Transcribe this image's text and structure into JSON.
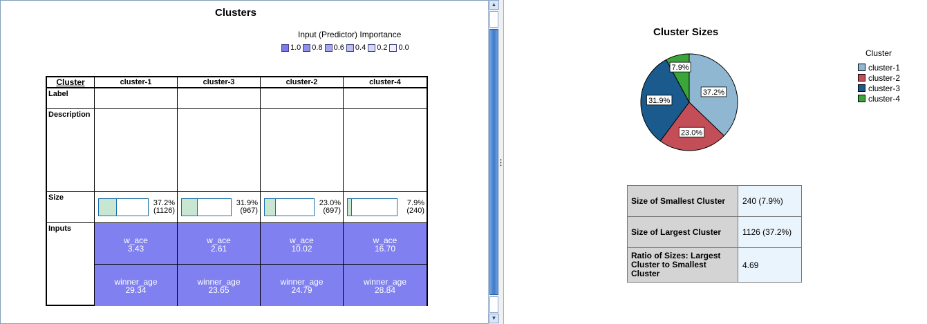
{
  "left": {
    "title": "Clusters",
    "importance": {
      "title": "Input (Predictor) Importance",
      "levels": [
        {
          "label": "1.0",
          "color": "#7b7bee"
        },
        {
          "label": "0.8",
          "color": "#8f8ff0"
        },
        {
          "label": "0.6",
          "color": "#a6a6f3"
        },
        {
          "label": "0.4",
          "color": "#bebef6"
        },
        {
          "label": "0.2",
          "color": "#d6d6f9"
        },
        {
          "label": "0.0",
          "color": "#efeffd"
        }
      ]
    },
    "grid": {
      "corner": "Cluster",
      "row_labels": {
        "label": "Label",
        "description": "Description",
        "size": "Size",
        "inputs": "Inputs"
      },
      "clusters": [
        {
          "name": "cluster-1",
          "size_pct": "37.2%",
          "size_n": "(1126)",
          "fill": 0.372,
          "inputs": [
            {
              "name": "w_ace",
              "value": "3.43"
            },
            {
              "name": "winner_age",
              "value": "29.34"
            }
          ]
        },
        {
          "name": "cluster-3",
          "size_pct": "31.9%",
          "size_n": "(967)",
          "fill": 0.319,
          "inputs": [
            {
              "name": "w_ace",
              "value": "2.61"
            },
            {
              "name": "winner_age",
              "value": "23.65"
            }
          ]
        },
        {
          "name": "cluster-2",
          "size_pct": "23.0%",
          "size_n": "(697)",
          "fill": 0.23,
          "inputs": [
            {
              "name": "w_ace",
              "value": "10.02"
            },
            {
              "name": "winner_age",
              "value": "24.79"
            }
          ]
        },
        {
          "name": "cluster-4",
          "size_pct": "7.9%",
          "size_n": "(240)",
          "fill": 0.079,
          "inputs": [
            {
              "name": "w_ace",
              "value": "16.70"
            },
            {
              "name": "winner_age",
              "value": "28.84"
            }
          ]
        }
      ]
    }
  },
  "right": {
    "title": "Cluster Sizes",
    "legend_title": "Cluster",
    "slices": [
      {
        "label": "cluster-1",
        "percent": 37.2,
        "text": "37.2%",
        "color": "#8fb7d1"
      },
      {
        "label": "cluster-2",
        "percent": 23.0,
        "text": "23.0%",
        "color": "#c44e58"
      },
      {
        "label": "cluster-3",
        "percent": 31.9,
        "text": "31.9%",
        "color": "#1a5a8c"
      },
      {
        "label": "cluster-4",
        "percent": 7.9,
        "text": "7.9%",
        "color": "#3aa53a"
      }
    ],
    "summary": [
      {
        "label": "Size of Smallest Cluster",
        "value": "240 (7.9%)"
      },
      {
        "label": "Size of Largest Cluster",
        "value": "1126 (37.2%)"
      },
      {
        "label": "Ratio of Sizes: Largest Cluster to Smallest Cluster",
        "value": "4.69"
      }
    ]
  }
}
